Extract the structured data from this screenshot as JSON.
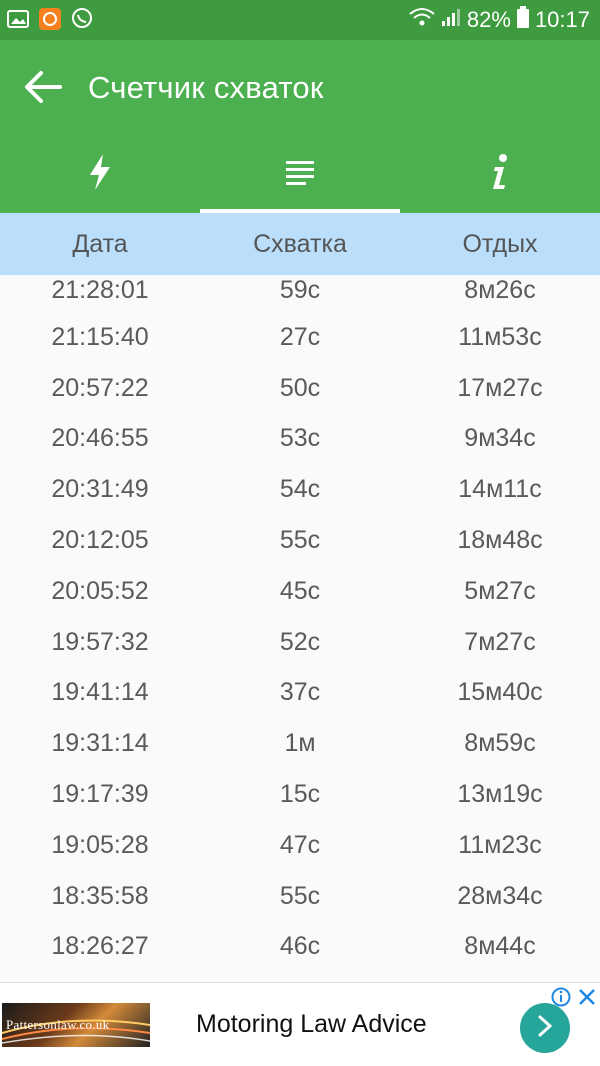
{
  "status_bar": {
    "battery": "82%",
    "time": "10:17"
  },
  "app_bar": {
    "title": "Счетчик схваток"
  },
  "tabs": [
    {
      "icon": "lightning-icon",
      "active": false
    },
    {
      "icon": "list-icon",
      "active": true
    },
    {
      "icon": "info-icon",
      "active": false
    }
  ],
  "table": {
    "headers": {
      "date": "Дата",
      "contraction": "Схватка",
      "rest": "Отдых"
    },
    "rows": [
      {
        "date": "21:28:01",
        "contraction": "59с",
        "rest": "8м26с"
      },
      {
        "date": "21:15:40",
        "contraction": "27с",
        "rest": "11м53с"
      },
      {
        "date": "20:57:22",
        "contraction": "50с",
        "rest": "17м27с"
      },
      {
        "date": "20:46:55",
        "contraction": "53с",
        "rest": "9м34с"
      },
      {
        "date": "20:31:49",
        "contraction": "54с",
        "rest": "14м11с"
      },
      {
        "date": "20:12:05",
        "contraction": "55с",
        "rest": "18м48с"
      },
      {
        "date": "20:05:52",
        "contraction": "45с",
        "rest": "5м27с"
      },
      {
        "date": "19:57:32",
        "contraction": "52с",
        "rest": "7м27с"
      },
      {
        "date": "19:41:14",
        "contraction": "37с",
        "rest": "15м40с"
      },
      {
        "date": "19:31:14",
        "contraction": "1м",
        "rest": "8м59с"
      },
      {
        "date": "19:17:39",
        "contraction": "15с",
        "rest": "13м19с"
      },
      {
        "date": "19:05:28",
        "contraction": "47с",
        "rest": "11м23с"
      },
      {
        "date": "18:35:58",
        "contraction": "55с",
        "rest": "28м34с"
      },
      {
        "date": "18:26:27",
        "contraction": "46с",
        "rest": "8м44с"
      }
    ]
  },
  "ad": {
    "thumb_text": "Pattersonlaw.co.uk",
    "title": "Motoring Law Advice"
  },
  "colors": {
    "status_bar": "#3f9b3f",
    "app_bar": "#4caf50",
    "table_header": "#bbdefb",
    "ad_button": "#26a69a"
  }
}
